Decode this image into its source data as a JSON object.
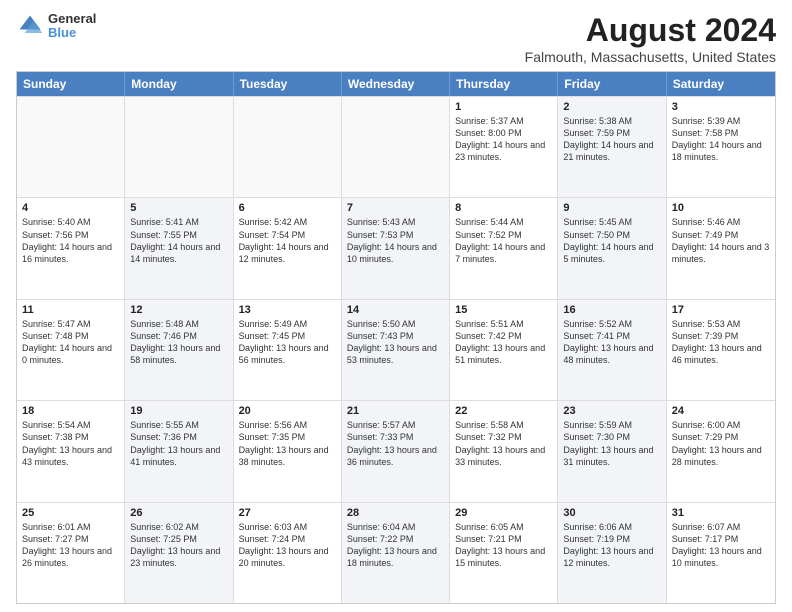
{
  "logo": {
    "general": "General",
    "blue": "Blue"
  },
  "header": {
    "title": "August 2024",
    "subtitle": "Falmouth, Massachusetts, United States"
  },
  "days_of_week": [
    "Sunday",
    "Monday",
    "Tuesday",
    "Wednesday",
    "Thursday",
    "Friday",
    "Saturday"
  ],
  "weeks": [
    [
      {
        "day": "",
        "text": "",
        "shaded": false,
        "empty": true
      },
      {
        "day": "",
        "text": "",
        "shaded": false,
        "empty": true
      },
      {
        "day": "",
        "text": "",
        "shaded": false,
        "empty": true
      },
      {
        "day": "",
        "text": "",
        "shaded": false,
        "empty": true
      },
      {
        "day": "1",
        "text": "Sunrise: 5:37 AM\nSunset: 8:00 PM\nDaylight: 14 hours\nand 23 minutes.",
        "shaded": false,
        "empty": false
      },
      {
        "day": "2",
        "text": "Sunrise: 5:38 AM\nSunset: 7:59 PM\nDaylight: 14 hours\nand 21 minutes.",
        "shaded": true,
        "empty": false
      },
      {
        "day": "3",
        "text": "Sunrise: 5:39 AM\nSunset: 7:58 PM\nDaylight: 14 hours\nand 18 minutes.",
        "shaded": false,
        "empty": false
      }
    ],
    [
      {
        "day": "4",
        "text": "Sunrise: 5:40 AM\nSunset: 7:56 PM\nDaylight: 14 hours\nand 16 minutes.",
        "shaded": false,
        "empty": false
      },
      {
        "day": "5",
        "text": "Sunrise: 5:41 AM\nSunset: 7:55 PM\nDaylight: 14 hours\nand 14 minutes.",
        "shaded": true,
        "empty": false
      },
      {
        "day": "6",
        "text": "Sunrise: 5:42 AM\nSunset: 7:54 PM\nDaylight: 14 hours\nand 12 minutes.",
        "shaded": false,
        "empty": false
      },
      {
        "day": "7",
        "text": "Sunrise: 5:43 AM\nSunset: 7:53 PM\nDaylight: 14 hours\nand 10 minutes.",
        "shaded": true,
        "empty": false
      },
      {
        "day": "8",
        "text": "Sunrise: 5:44 AM\nSunset: 7:52 PM\nDaylight: 14 hours\nand 7 minutes.",
        "shaded": false,
        "empty": false
      },
      {
        "day": "9",
        "text": "Sunrise: 5:45 AM\nSunset: 7:50 PM\nDaylight: 14 hours\nand 5 minutes.",
        "shaded": true,
        "empty": false
      },
      {
        "day": "10",
        "text": "Sunrise: 5:46 AM\nSunset: 7:49 PM\nDaylight: 14 hours\nand 3 minutes.",
        "shaded": false,
        "empty": false
      }
    ],
    [
      {
        "day": "11",
        "text": "Sunrise: 5:47 AM\nSunset: 7:48 PM\nDaylight: 14 hours\nand 0 minutes.",
        "shaded": false,
        "empty": false
      },
      {
        "day": "12",
        "text": "Sunrise: 5:48 AM\nSunset: 7:46 PM\nDaylight: 13 hours\nand 58 minutes.",
        "shaded": true,
        "empty": false
      },
      {
        "day": "13",
        "text": "Sunrise: 5:49 AM\nSunset: 7:45 PM\nDaylight: 13 hours\nand 56 minutes.",
        "shaded": false,
        "empty": false
      },
      {
        "day": "14",
        "text": "Sunrise: 5:50 AM\nSunset: 7:43 PM\nDaylight: 13 hours\nand 53 minutes.",
        "shaded": true,
        "empty": false
      },
      {
        "day": "15",
        "text": "Sunrise: 5:51 AM\nSunset: 7:42 PM\nDaylight: 13 hours\nand 51 minutes.",
        "shaded": false,
        "empty": false
      },
      {
        "day": "16",
        "text": "Sunrise: 5:52 AM\nSunset: 7:41 PM\nDaylight: 13 hours\nand 48 minutes.",
        "shaded": true,
        "empty": false
      },
      {
        "day": "17",
        "text": "Sunrise: 5:53 AM\nSunset: 7:39 PM\nDaylight: 13 hours\nand 46 minutes.",
        "shaded": false,
        "empty": false
      }
    ],
    [
      {
        "day": "18",
        "text": "Sunrise: 5:54 AM\nSunset: 7:38 PM\nDaylight: 13 hours\nand 43 minutes.",
        "shaded": false,
        "empty": false
      },
      {
        "day": "19",
        "text": "Sunrise: 5:55 AM\nSunset: 7:36 PM\nDaylight: 13 hours\nand 41 minutes.",
        "shaded": true,
        "empty": false
      },
      {
        "day": "20",
        "text": "Sunrise: 5:56 AM\nSunset: 7:35 PM\nDaylight: 13 hours\nand 38 minutes.",
        "shaded": false,
        "empty": false
      },
      {
        "day": "21",
        "text": "Sunrise: 5:57 AM\nSunset: 7:33 PM\nDaylight: 13 hours\nand 36 minutes.",
        "shaded": true,
        "empty": false
      },
      {
        "day": "22",
        "text": "Sunrise: 5:58 AM\nSunset: 7:32 PM\nDaylight: 13 hours\nand 33 minutes.",
        "shaded": false,
        "empty": false
      },
      {
        "day": "23",
        "text": "Sunrise: 5:59 AM\nSunset: 7:30 PM\nDaylight: 13 hours\nand 31 minutes.",
        "shaded": true,
        "empty": false
      },
      {
        "day": "24",
        "text": "Sunrise: 6:00 AM\nSunset: 7:29 PM\nDaylight: 13 hours\nand 28 minutes.",
        "shaded": false,
        "empty": false
      }
    ],
    [
      {
        "day": "25",
        "text": "Sunrise: 6:01 AM\nSunset: 7:27 PM\nDaylight: 13 hours\nand 26 minutes.",
        "shaded": false,
        "empty": false
      },
      {
        "day": "26",
        "text": "Sunrise: 6:02 AM\nSunset: 7:25 PM\nDaylight: 13 hours\nand 23 minutes.",
        "shaded": true,
        "empty": false
      },
      {
        "day": "27",
        "text": "Sunrise: 6:03 AM\nSunset: 7:24 PM\nDaylight: 13 hours\nand 20 minutes.",
        "shaded": false,
        "empty": false
      },
      {
        "day": "28",
        "text": "Sunrise: 6:04 AM\nSunset: 7:22 PM\nDaylight: 13 hours\nand 18 minutes.",
        "shaded": true,
        "empty": false
      },
      {
        "day": "29",
        "text": "Sunrise: 6:05 AM\nSunset: 7:21 PM\nDaylight: 13 hours\nand 15 minutes.",
        "shaded": false,
        "empty": false
      },
      {
        "day": "30",
        "text": "Sunrise: 6:06 AM\nSunset: 7:19 PM\nDaylight: 13 hours\nand 12 minutes.",
        "shaded": true,
        "empty": false
      },
      {
        "day": "31",
        "text": "Sunrise: 6:07 AM\nSunset: 7:17 PM\nDaylight: 13 hours\nand 10 minutes.",
        "shaded": false,
        "empty": false
      }
    ]
  ]
}
